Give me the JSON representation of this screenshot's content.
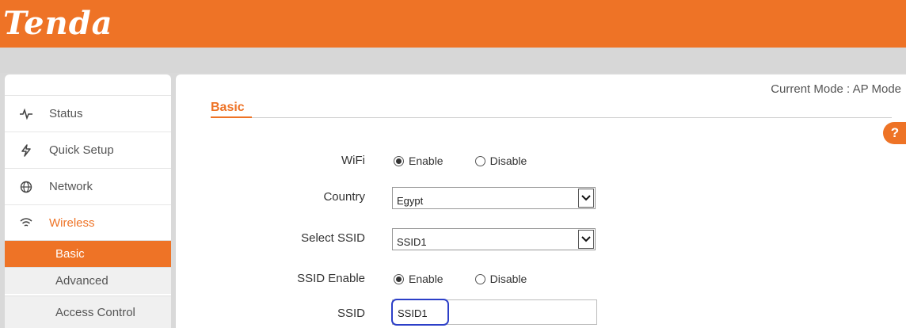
{
  "header": {
    "logo_text": "Tenda",
    "brand_color": "#ee7326"
  },
  "sidebar": {
    "items": [
      {
        "label": "Status",
        "icon": "pulse-icon"
      },
      {
        "label": "Quick Setup",
        "icon": "lightning-icon"
      },
      {
        "label": "Network",
        "icon": "globe-icon"
      },
      {
        "label": "Wireless",
        "icon": "wifi-icon",
        "active": true
      }
    ],
    "subitems": [
      {
        "label": "Basic",
        "active": true
      },
      {
        "label": "Advanced"
      },
      {
        "label": "Access Control"
      }
    ]
  },
  "main": {
    "mode_text": "Current Mode : AP Mode",
    "section_title": "Basic",
    "help_label": "?",
    "wifi": {
      "label": "WiFi",
      "enable": "Enable",
      "disable": "Disable",
      "selected": "Enable"
    },
    "country": {
      "label": "Country",
      "value": "Egypt"
    },
    "select_ssid": {
      "label": "Select SSID",
      "value": "SSID1"
    },
    "ssid_enable": {
      "label": "SSID Enable",
      "enable": "Enable",
      "disable": "Disable",
      "selected": "Enable"
    },
    "ssid": {
      "label": "SSID",
      "value": "SSID1"
    }
  }
}
